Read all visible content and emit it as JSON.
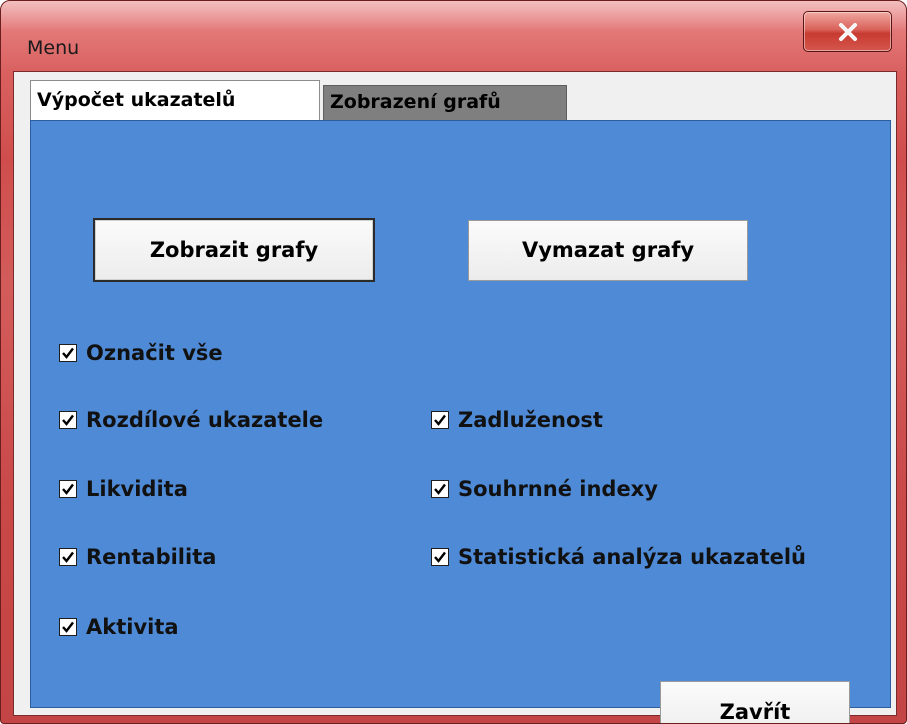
{
  "window": {
    "title": "Menu",
    "close_icon": "close-icon"
  },
  "tabs": [
    {
      "label": "Výpočet ukazatelů",
      "selected": false
    },
    {
      "label": "Zobrazení grafů",
      "selected": true
    }
  ],
  "buttons": {
    "show": "Zobrazit grafy",
    "clear": "Vymazat grafy",
    "close": "Zavřít"
  },
  "checkboxes": {
    "select_all": {
      "label": "Označit vše",
      "checked": true
    },
    "diff": {
      "label": "Rozdílové ukazatele",
      "checked": true
    },
    "liquidity": {
      "label": "Likvidita",
      "checked": true
    },
    "profitability": {
      "label": "Rentabilita",
      "checked": true
    },
    "activity": {
      "label": "Aktivita",
      "checked": true
    },
    "debt": {
      "label": "Zadluženost",
      "checked": true
    },
    "summary": {
      "label": "Souhrnné indexy",
      "checked": true
    },
    "stats": {
      "label": "Statistická analýza ukazatelů",
      "checked": true
    }
  },
  "colors": {
    "title_bar": "#cf4e4d",
    "panel": "#4f8ad6",
    "selected_tab": "#7f7f7f"
  }
}
